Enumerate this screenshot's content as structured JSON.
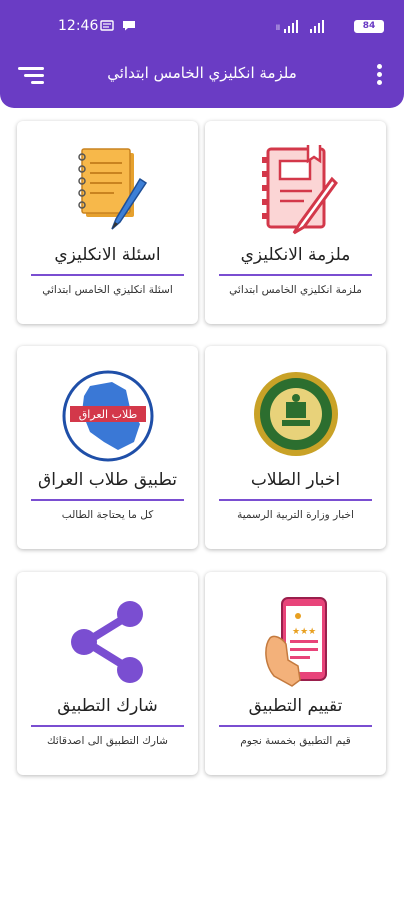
{
  "status_bar": {
    "time": "12:46",
    "battery": "84"
  },
  "app_bar": {
    "title": "ملزمة انكليزي الخامس ابتدائي",
    "accent_color": "#6a3cc4"
  },
  "cards": [
    {
      "title": "ملزمة الانكليزي",
      "subtitle": "ملزمة انكليزي الخامس ابتدائي",
      "icon": "notebook-pen-icon"
    },
    {
      "title": "اسئلة الانكليزي",
      "subtitle": "اسئلة انكليزي الخامس ابتدائي",
      "icon": "notepad-pencil-icon"
    },
    {
      "title": "اخبار الطلاب",
      "subtitle": "اخبار وزارة التربية الرسمية",
      "icon": "ministry-seal-icon"
    },
    {
      "title": "تطبيق طلاب العراق",
      "subtitle": "كل ما يحتاجة الطالب",
      "icon": "iraq-map-logo-icon",
      "logo_text": "طلاب العراق"
    },
    {
      "title": "تقييم التطبيق",
      "subtitle": "قيم التطبيق بخمسة نجوم",
      "icon": "phone-rating-icon"
    },
    {
      "title": "شارك التطبيق",
      "subtitle": "شارك التطبيق الى اصدقائك",
      "icon": "share-icon"
    }
  ]
}
